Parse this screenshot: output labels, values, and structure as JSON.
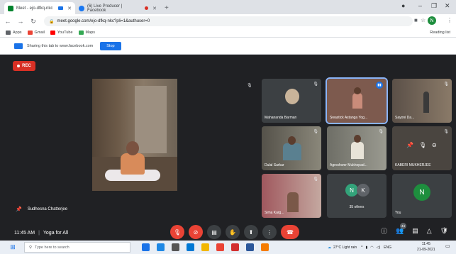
{
  "browser": {
    "tabs": [
      {
        "label": "Meet - ejo-dfkq-nkc",
        "active": true,
        "favicon_color": "#00832d"
      },
      {
        "label": "(6) Live Producer | Facebook",
        "active": false,
        "favicon_color": "#1877f2"
      }
    ],
    "new_tab": "+",
    "url": "meet.google.com/ejo-dfkq-nkc?pli=1&authuser=0",
    "profile_initial": "N",
    "bookmarks": [
      {
        "label": "Apps",
        "color": "#5f6368"
      },
      {
        "label": "Gmail",
        "color": "#ea4335"
      },
      {
        "label": "YouTube",
        "color": "#ff0000"
      },
      {
        "label": "Maps",
        "color": "#34a853"
      }
    ],
    "reading_list": "Reading list"
  },
  "share_bar": {
    "text": "Sharing this tab to www.facebook.com",
    "stop_label": "Stop"
  },
  "meet": {
    "rec_label": "REC",
    "main_participant": "Sudhesna Chatterjee",
    "tiles": [
      {
        "name": "Mahananda Barman",
        "bg": "#3c4043"
      },
      {
        "name": "Swastick Astanga Yog...",
        "bg": "#7d5a4e",
        "active": true
      },
      {
        "name": "Sayoni Da...",
        "bg": "#5b5048"
      },
      {
        "name": "Dulal Sarkar",
        "bg": "#6d6a5e"
      },
      {
        "name": "Agroshwer Mukhopad...",
        "bg": "#7a7a70"
      },
      {
        "name": "KABERI MUKHERJEE",
        "bg": "#4a4540"
      },
      {
        "name": "Sima Karg...",
        "bg": "#a0585e"
      },
      {
        "name": "35 others",
        "initials": [
          "N",
          "K"
        ],
        "bg": "#3c4043"
      },
      {
        "name": "You",
        "initial": "N",
        "bg": "#3c4043"
      }
    ],
    "time": "11:45 AM",
    "meeting_title": "Yoga for All",
    "participants_count": "44"
  },
  "taskbar": {
    "search_placeholder": "Type here to search",
    "weather": "27°C Light rain",
    "language": "ENG",
    "time": "11:45",
    "date": "21-09-2021"
  },
  "colors": {
    "meet_bg": "#202124",
    "accent": "#1a73e8",
    "danger": "#ea4335"
  }
}
